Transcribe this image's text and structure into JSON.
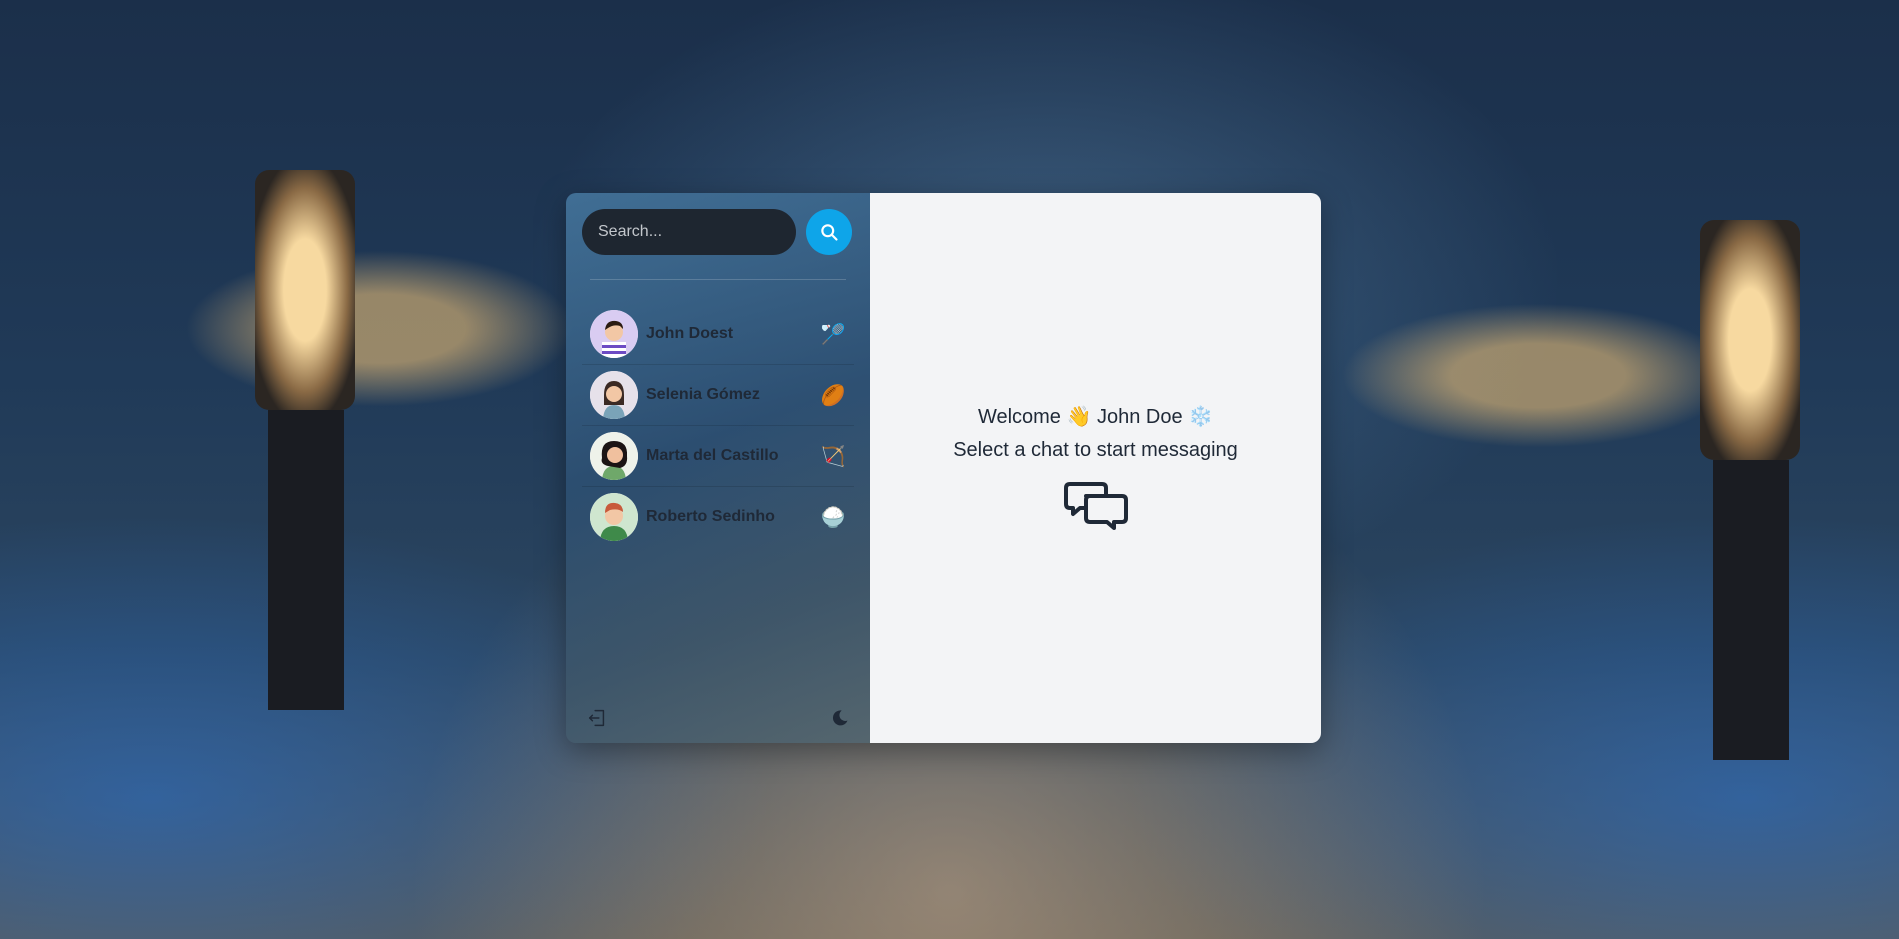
{
  "search": {
    "placeholder": "Search..."
  },
  "contacts": [
    {
      "name": "John Doest",
      "emoji": "🏸",
      "avatar_bg": "#d9ccf2",
      "hair": "#2b1b12",
      "shirt": "#6d4bc4"
    },
    {
      "name": "Selenia Gómez",
      "emoji": "🏉",
      "avatar_bg": "#e6e1ea",
      "hair": "#3b2a24",
      "shirt": "#7aa3b8"
    },
    {
      "name": "Marta del Castillo",
      "emoji": "🏹",
      "avatar_bg": "#eef2ea",
      "hair": "#1b1414",
      "shirt": "#6fa86a"
    },
    {
      "name": "Roberto Sedinho",
      "emoji": "🍚",
      "avatar_bg": "#cfe6cf",
      "hair": "#c85a3b",
      "shirt": "#3f8a4a"
    }
  ],
  "main": {
    "welcome_prefix": "Welcome",
    "wave_emoji": "👋",
    "user_name": "John Doe",
    "snow_emoji": "❄️",
    "prompt": "Select a chat to start messaging"
  },
  "colors": {
    "accent": "#0ea5e9",
    "main_bg": "#f3f4f6",
    "search_bg": "#1e2630"
  },
  "icons": {
    "search": "search-icon",
    "logout": "logout-icon",
    "theme": "moon-icon",
    "chat": "chat-bubbles-icon"
  }
}
